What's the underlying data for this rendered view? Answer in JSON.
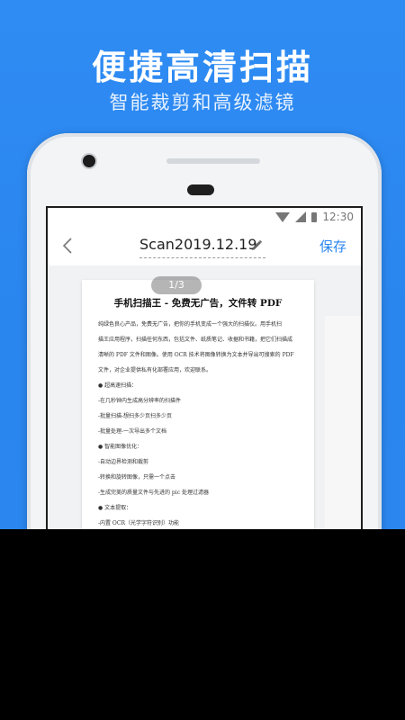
{
  "hero": {
    "headline": "便捷高清扫描",
    "subline": "智能裁剪和高级滤镜"
  },
  "phone": {
    "status": {
      "time": "12:30"
    },
    "appbar": {
      "title": "Scan2019.12.19",
      "save_label": "保存"
    },
    "page_indicator": "1/3",
    "document": {
      "title": "手机扫描王 - 免费无广告，文件转 PDF",
      "lines": [
        "纯绿色良心产品，免费无广告，把你的手机变成一个强大的扫描仪。用手机扫",
        "描王应用程序，扫描任何东西，包括文件、纸质笔记、收据和书籍，把它们扫描成",
        "清晰的 PDF 文件和图像。使用 OCR 技术将图像转换为文本并导出可搜索的 PDF",
        "文件，对企业提供私有化部署应用，欢迎联系。",
        "●   超高速扫描：",
        "-在几秒钟内生成高分辨率的扫描件",
        "-批量扫描-想扫多少页扫多少页",
        "-批量处理-一次导出多个文档",
        "●   智能图像优化：",
        "-自动边界检测和裁剪",
        "-转换和旋转图像，只需一个点击",
        "-生成完美的质量文件与先进的 pic 处理过滤器",
        "●   文本提取：",
        "-内置 OCR（光学字符识别）功能"
      ]
    }
  },
  "colors": {
    "accent": "#2a86ef",
    "background": "#2f8cf3"
  }
}
